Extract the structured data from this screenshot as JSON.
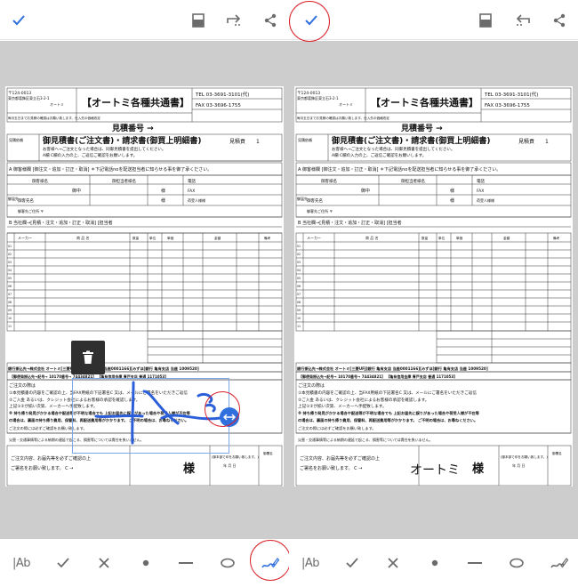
{
  "left_pane": {
    "toolbar": {
      "done": "check-icon",
      "frame": "frame-icon",
      "redo": "redo-icon",
      "share": "share-icon",
      "confirm": "check-icon"
    },
    "delete_icon": "trash-icon",
    "resize_handle": "resize-arrows-icon",
    "bottom_tools": {
      "text_label": "|Ab",
      "check": "check-icon",
      "cross": "cross-icon",
      "dot": "dot-icon",
      "line": "line-icon",
      "ellipse": "ellipse-icon",
      "sign": "signature-icon"
    }
  },
  "right_pane": {
    "toolbar": {
      "frame": "frame-icon",
      "undo": "undo-icon",
      "share": "share-icon"
    },
    "bottom_tools": {
      "text_label": "|Ab",
      "check": "check-icon",
      "cross": "cross-icon",
      "dot": "dot-icon",
      "line": "line-icon",
      "ellipse": "ellipse-icon",
      "sign": "signature-icon"
    }
  },
  "document": {
    "postal": "〒124-0013",
    "address": "東京都葛飾区東立石3-2-1",
    "company": "オートミ",
    "title": "【オートミ各種共通書】",
    "tel": "TEL 03-3691-3101(代)",
    "fax": "FAX 03-3696-1755",
    "notice_top": "毎月五日までお見積の確認はお願い致します。仕入先の価格改定",
    "estimate_no": "見積番号 →",
    "estimate_label": "見積依頼",
    "title2": "御見積書(ご注文書)・請求書(御買上明細書)",
    "estimate_page_prefix": "見積貢",
    "estimate_page": "1",
    "line_a1": "お客様へ→ご注文となった場合は、同御見積書を提出してください。",
    "line_a2": "A欄 C欄の入力の上、ご返信ご確認をお願いします。",
    "section_a": "A 御客様欄 [御注文・追加・訂正・取消] ＊下記電話noを配送担当者に知らせる事を御了承ください。",
    "customer_name": "御客様名",
    "person_name": "御担当者様名",
    "phone": "電話",
    "goon": "御中",
    "sama": "様",
    "fax_short": "FAX",
    "delivery": "御届先",
    "customer": "御客先名",
    "customer_sama": "様",
    "delivery_person": "荷受人様様",
    "address_label": "御客先ご住所 〒",
    "section_b": "B 当社欄→[見積・注文・追加・訂正・取消] [担当者",
    "header_row": "メーカー",
    "col_product": "商 品 名",
    "col_qty": "数量",
    "col_unit": "単位",
    "col_price": "単価",
    "col_amount": "金額",
    "col_note": "備考",
    "row_labels": [
      "01",
      "02",
      "03",
      "04",
      "05",
      "06",
      "07",
      "08",
      "09",
      "10",
      "11",
      "12",
      "13",
      "14"
    ],
    "bank_line": "銀行振込先→株式会社 オートミ[三菱UFJ]銀行 亀有支店 当座0001166][みずほ]銀行 亀有支店 当座 1009520]",
    "post_line": "【郵便局振込先→記号→ 10170番号→ 74434821】 【亀有信用金庫 青戸支店 普通 1171053】",
    "order_title": "ご注文の際は",
    "order_1": "①本見積書の内容をご確認の上、当FAX用紙の下記署名C 又は、メールにご署名をいただきご返信",
    "order_2": "②ご入金 あるいは、クレジット会社によるお客様の承認を確認します。",
    "order_3": "上記①②が揃い次第、メーカーへ手配致します。",
    "order_4": "※ 持ち帰り発見がかかる場合や配送等が不明な場合でも 上記お届先に誤りがあった場合や荷受人様が不在等",
    "order_5": "の場合は、裏面の持ち帰り費用、保管料、再配送費用等がかかります。 ご不明の場合は、お尋ねください。",
    "order_6": "ご注文の際には必ずご確認をお願い致します。",
    "disaster": "災害・交通事情等による納期の遅延で起こる、損害等については責任を負いません。",
    "confirm_1": "ご注文内容、お届先等を必ずご確認の上",
    "confirm_2": "ご署名をお願い致します。 C →",
    "sama_big": "様",
    "seal_note": "(御本部で印をお願い致します。)",
    "ymd": "年 月 日",
    "seal_label": "御署名",
    "signature_right": "オートミ"
  }
}
